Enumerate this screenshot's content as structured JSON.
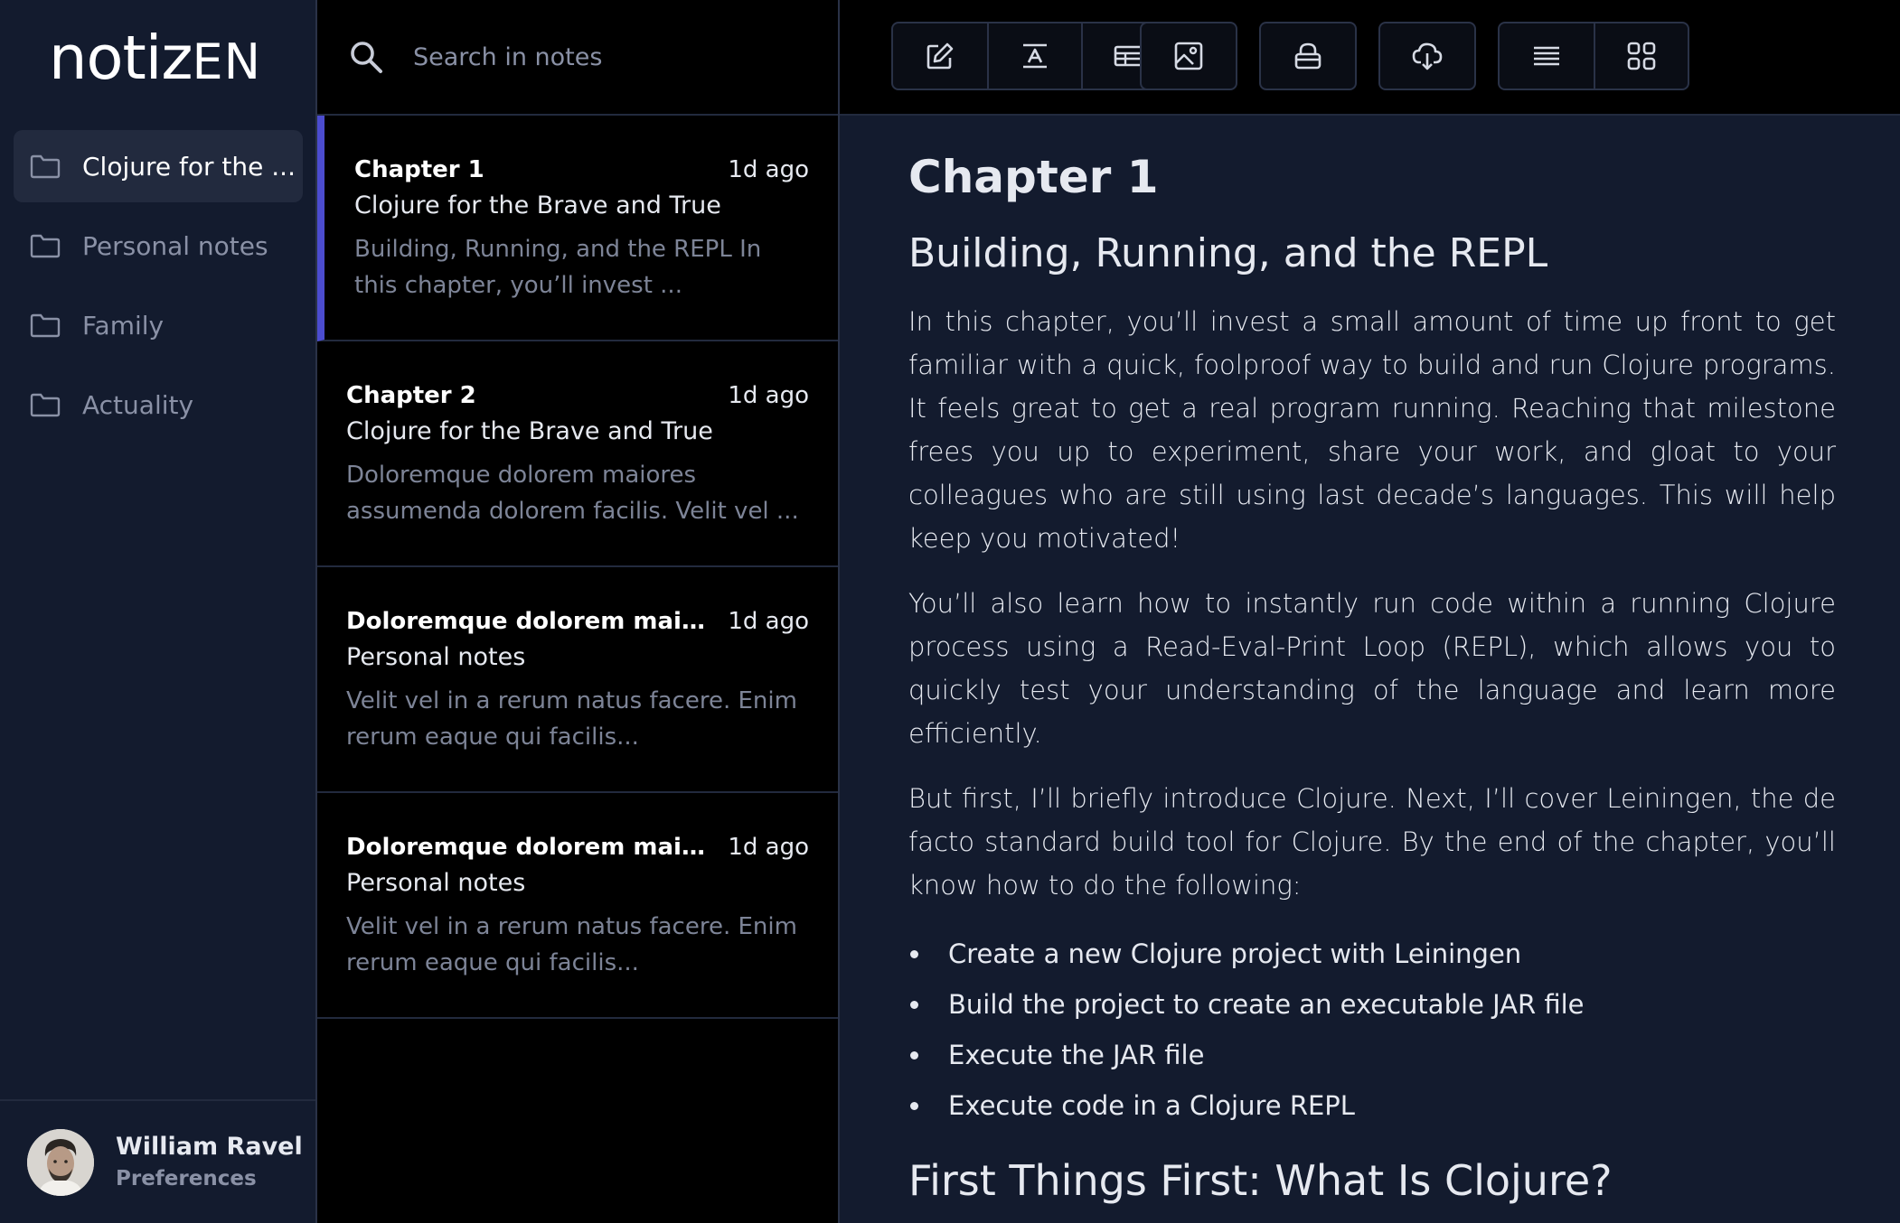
{
  "app": {
    "logo_main": "notiz",
    "logo_accent": "EN"
  },
  "sidebar": {
    "folders": [
      {
        "label": "Clojure for the ...",
        "active": true
      },
      {
        "label": "Personal notes",
        "active": false
      },
      {
        "label": "Family",
        "active": false
      },
      {
        "label": "Actuality",
        "active": false
      }
    ],
    "user": {
      "name": "William Ravel",
      "link": "Preferences"
    }
  },
  "search": {
    "placeholder": "Search in notes"
  },
  "notes": [
    {
      "title": "Chapter 1",
      "time": "1d ago",
      "folder": "Clojure for the Brave and True",
      "preview": "Building, Running, and the REPL In this chapter, you’ll invest ..."
    },
    {
      "title": "Chapter 2",
      "time": "1d ago",
      "folder": "Clojure for the Brave and True",
      "preview": "Doloremque dolorem maiores assumenda dolorem facilis. Velit vel ..."
    },
    {
      "title": "Doloremque dolorem maiores...",
      "time": "1d ago",
      "folder": "Personal notes",
      "preview": "Velit vel in a rerum natus facere. Enim rerum eaque qui facilis..."
    },
    {
      "title": "Doloremque dolorem maiores...",
      "time": "1d ago",
      "folder": "Personal notes",
      "preview": "Velit vel in a rerum natus facere. Enim rerum eaque qui facilis..."
    }
  ],
  "toolbar": {
    "buttons": [
      "edit-icon",
      "text-format-icon",
      "table-icon",
      "image-icon",
      "lock-icon",
      "cloud-download-icon",
      "list-view-icon",
      "grid-view-icon"
    ]
  },
  "editor": {
    "h1": "Chapter 1",
    "h2": "Building, Running, and the REPL",
    "paragraphs": [
      "In this chapter, you’ll invest a small amount of time up front to get familiar with a quick, foolproof way to build and run Clojure programs. It feels great to get a real program running. Reaching that milestone frees you up to experiment, share your work, and gloat to your colleagues who are still using last decade’s languages. This will help keep you motivated!",
      "You’ll also learn how to instantly run code within a running Clojure process using a Read-Eval-Print Loop (REPL), which allows you to quickly test your understanding of the language and learn more efficiently.",
      "But first, I’ll briefly introduce Clojure. Next, I’ll cover Leiningen, the de facto standard build tool for Clojure. By the end of the chapter, you’ll know how to do the following:"
    ],
    "bullets": [
      "Create a new Clojure project with Leiningen",
      "Build the project to create an executable JAR file",
      "Execute the JAR file",
      "Execute code in a Clojure REPL"
    ],
    "h2_next": "First Things First: What Is Clojure?"
  },
  "colors": {
    "sidebar_bg": "#131b2e",
    "list_bg": "#000000",
    "active_accent": "#4b4ccf",
    "text": "#e6e9f0",
    "muted": "#8a91a6"
  }
}
